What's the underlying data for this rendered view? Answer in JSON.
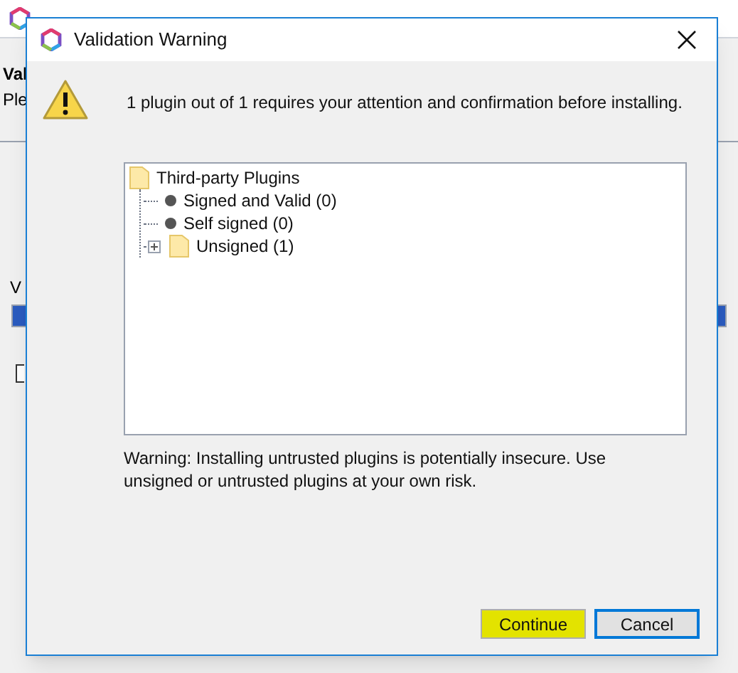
{
  "background_window": {
    "heading": "Val",
    "subheading": "Ple",
    "field_label": "V",
    "checkbox": {
      "checked": false
    }
  },
  "dialog": {
    "title": "Validation Warning",
    "message": "1 plugin out of 1 requires your attention and confirmation before installing.",
    "tree": {
      "label": "Third-party Plugins",
      "kind": "folder",
      "children": [
        {
          "label": "Signed and Valid (0)",
          "kind": "leaf"
        },
        {
          "label": "Self signed (0)",
          "kind": "leaf"
        },
        {
          "label": "Unsigned (1)",
          "kind": "folder",
          "expanded": false
        }
      ]
    },
    "warning": "Warning: Installing untrusted plugins is potentially insecure. Use unsigned or untrusted plugins at your own risk.",
    "buttons": [
      {
        "label": "Continue",
        "highlighted": true,
        "focused": false
      },
      {
        "label": "Cancel",
        "highlighted": false,
        "focused": true
      }
    ]
  }
}
